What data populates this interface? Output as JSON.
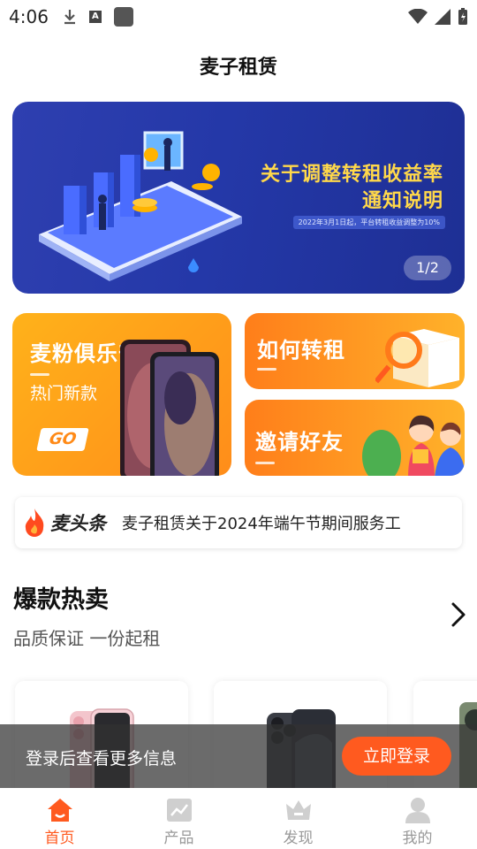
{
  "status_bar": {
    "time": "4:06"
  },
  "header": {
    "title": "麦子租赁"
  },
  "banner": {
    "headline_line1": "关于调整转租收益率",
    "headline_line2": "通知说明",
    "sub": "2022年3月1日起，平台转租收益调整为10%",
    "pager": "1/2"
  },
  "cards": {
    "club_title": "麦粉俱乐部",
    "club_sub": "热门新款",
    "club_go": "GO",
    "transfer_title": "如何转租",
    "invite_title": "邀请好友"
  },
  "ticker": {
    "brand": "麦头条",
    "text": "麦子租赁关于2024年端午节期间服务工"
  },
  "section": {
    "title": "爆款热卖",
    "subtitle": "品质保证 一份起租"
  },
  "login_toast": {
    "text": "登录后查看更多信息",
    "button": "立即登录"
  },
  "tabs": [
    {
      "label": "首页",
      "icon": "home-icon"
    },
    {
      "label": "产品",
      "icon": "chart-icon"
    },
    {
      "label": "发现",
      "icon": "crown-icon"
    },
    {
      "label": "我的",
      "icon": "user-icon"
    }
  ],
  "colors": {
    "accent": "#ff5a1f",
    "card_orange": "#ff9a1a",
    "banner_blue": "#2438a8"
  }
}
